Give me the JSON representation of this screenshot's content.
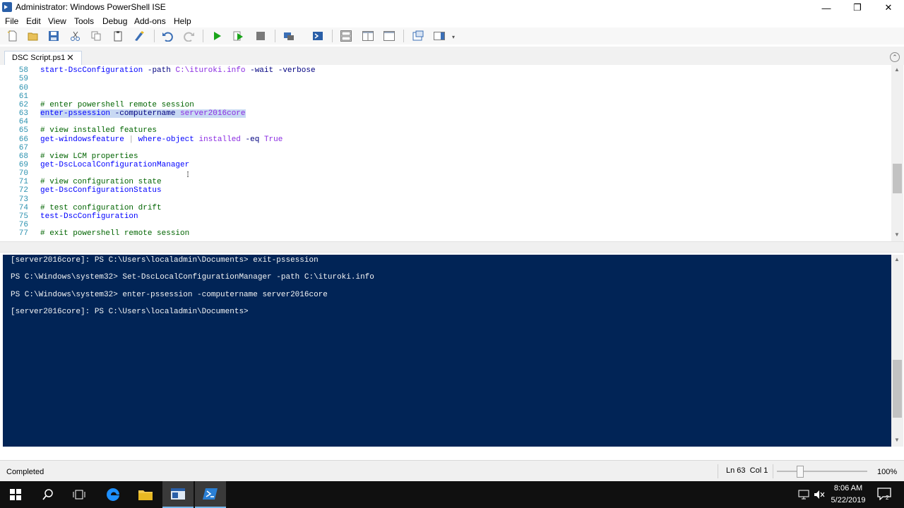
{
  "window": {
    "title": "Administrator: Windows PowerShell ISE",
    "minimize": "—",
    "restore": "❐",
    "close": "✕"
  },
  "menu": [
    "File",
    "Edit",
    "View",
    "Tools",
    "Debug",
    "Add-ons",
    "Help"
  ],
  "tab": {
    "label": "DSC Script.ps1",
    "close": "✕"
  },
  "editor": {
    "lines": [
      {
        "n": "58",
        "code": "start-DscConfiguration -path C:\\ituroki.info -wait -verbose"
      },
      {
        "n": "59",
        "code": ""
      },
      {
        "n": "60",
        "code": ""
      },
      {
        "n": "61",
        "code": ""
      },
      {
        "n": "62",
        "code": "# enter powershell remote session"
      },
      {
        "n": "63",
        "code": "enter-pssession -computername server2016core"
      },
      {
        "n": "64",
        "code": ""
      },
      {
        "n": "65",
        "code": "# view installed features"
      },
      {
        "n": "66",
        "code": "get-windowsfeature | where-object installed -eq True"
      },
      {
        "n": "67",
        "code": ""
      },
      {
        "n": "68",
        "code": "# view LCM properties"
      },
      {
        "n": "69",
        "code": "get-DscLocalConfigurationManager"
      },
      {
        "n": "70",
        "code": ""
      },
      {
        "n": "71",
        "code": "# view configuration state"
      },
      {
        "n": "72",
        "code": "get-DscConfigurationStatus"
      },
      {
        "n": "73",
        "code": ""
      },
      {
        "n": "74",
        "code": "# test configuration drift"
      },
      {
        "n": "75",
        "code": "test-DscConfiguration"
      },
      {
        "n": "76",
        "code": ""
      },
      {
        "n": "77",
        "code": "# exit powershell remote session"
      }
    ]
  },
  "console": {
    "lines": [
      "[server2016core]: PS C:\\Users\\localadmin\\Documents> exit-pssession",
      "PS C:\\Windows\\system32> Set-DscLocalConfigurationManager -path C:\\ituroki.info",
      "PS C:\\Windows\\system32> enter-pssession -computername server2016core",
      "[server2016core]: PS C:\\Users\\localadmin\\Documents>"
    ]
  },
  "status": {
    "text": "Completed",
    "position": "Ln 63  Col 1",
    "zoom": "100%"
  },
  "taskbar": {
    "time": "8:06 AM",
    "date": "5/22/2019"
  },
  "colors": {
    "console_bg": "#012456",
    "cmdlet": "#0000ff",
    "comment": "#006400",
    "parameter": "#000080",
    "argument": "#8a2be2",
    "selection": "#c8d9f3"
  }
}
